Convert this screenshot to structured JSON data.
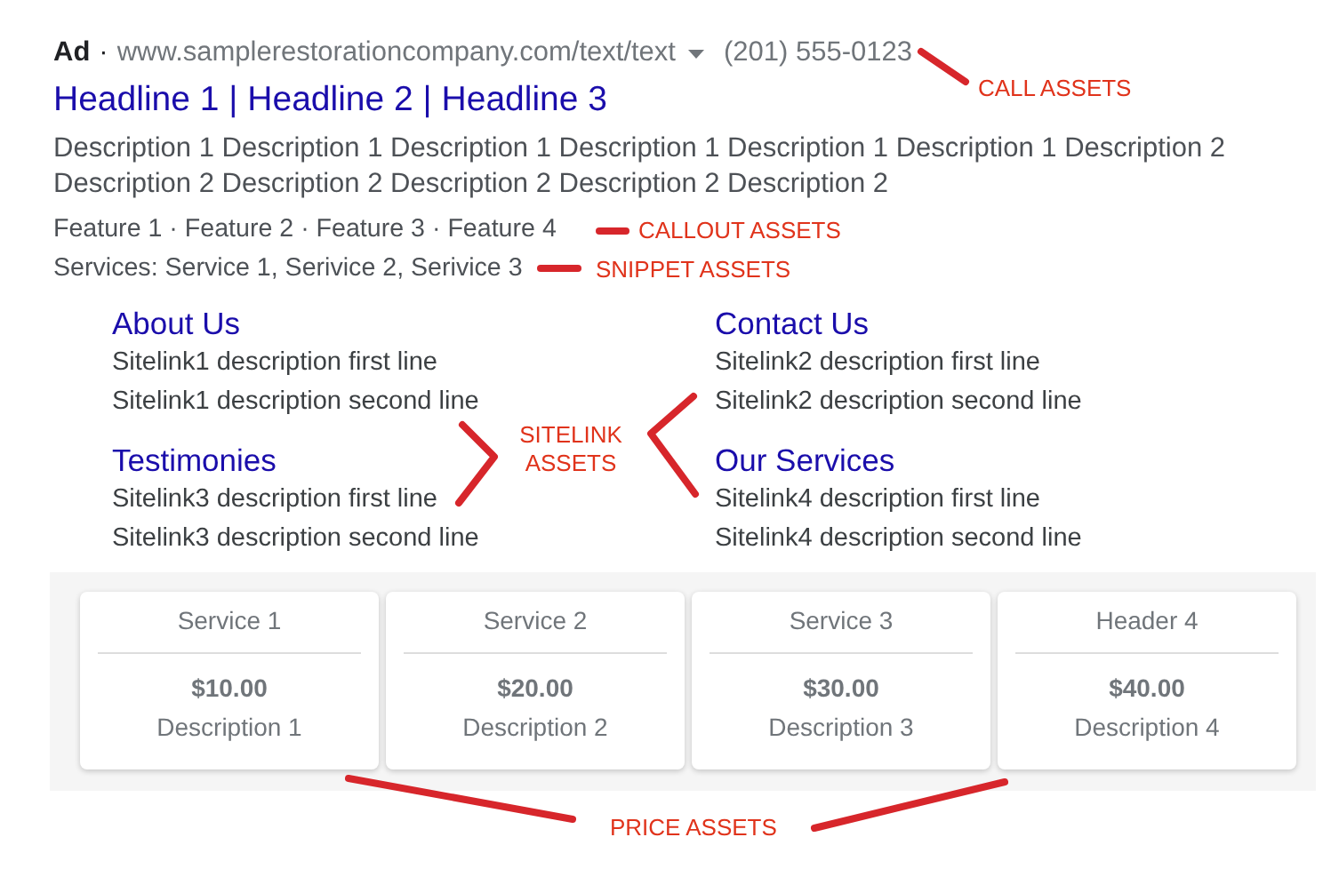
{
  "ad": {
    "label": "Ad",
    "separator": "·",
    "url": "www.samplerestorationcompany.com/text/text",
    "phone": "(201) 555-0123",
    "headline": "Headline 1 | Headline 2 | Headline 3",
    "description_lines": [
      "Description 1 Description 1 Description 1 Description 1 Description 1 Description 1 Description 2",
      "Description 2 Description 2 Description 2 Description 2 Description 2"
    ],
    "callouts": "Feature 1 · Feature 2 · Feature 3 · Feature 4",
    "snippet": "Services: Service 1, Serivice 2, Serivice 3",
    "sitelinks": [
      {
        "title": "About Us",
        "lines": [
          "Sitelink1 description first line",
          "Sitelink1 description second line"
        ]
      },
      {
        "title": "Contact Us",
        "lines": [
          "Sitelink2 description first line",
          "Sitelink2 description second line"
        ]
      },
      {
        "title": "Testimonies",
        "lines": [
          "Sitelink3 description first line",
          "Sitelink3 description second line"
        ]
      },
      {
        "title": "Our Services",
        "lines": [
          "Sitelink4 description first line",
          "Sitelink4 description second line"
        ]
      }
    ],
    "prices": [
      {
        "header": "Service 1",
        "price": "$10.00",
        "description": "Description 1"
      },
      {
        "header": "Service 2",
        "price": "$20.00",
        "description": "Description 2"
      },
      {
        "header": "Service 3",
        "price": "$30.00",
        "description": "Description 3"
      },
      {
        "header": "Header 4",
        "price": "$40.00",
        "description": "Description 4"
      }
    ]
  },
  "annotations": [
    {
      "kind": "call",
      "label": "CALL ASSETS"
    },
    {
      "kind": "callout",
      "label": "CALLOUT ASSETS"
    },
    {
      "kind": "snippet",
      "label": "SNIPPET ASSETS"
    },
    {
      "kind": "sitelink",
      "label": "SITELINK ASSETS"
    },
    {
      "kind": "price",
      "label": "PRICE ASSETS"
    }
  ]
}
